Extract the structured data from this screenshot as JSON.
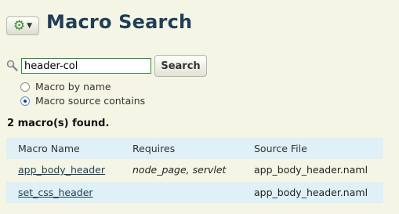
{
  "header": {
    "title": "Macro Search",
    "menu_icon": "gear-icon",
    "menu_caret": "chevron-down-icon"
  },
  "search": {
    "value": "header-col",
    "button_label": "Search",
    "icon": "magnifier-icon"
  },
  "options": [
    {
      "label": "Macro by name",
      "selected": false
    },
    {
      "label": "Macro source contains",
      "selected": true
    }
  ],
  "results": {
    "summary": "2 macro(s) found.",
    "columns": [
      "Macro Name",
      "Requires",
      "Source File"
    ],
    "rows": [
      {
        "name": "app_body_header",
        "requires": "node_page, servlet",
        "file": "app_body_header.naml"
      },
      {
        "name": "set_css_header",
        "requires": "",
        "file": "app_body_header.naml"
      }
    ]
  },
  "colors": {
    "background": "#f5f5e6",
    "title": "#1f3e57",
    "table_stripe": "#dff0f6",
    "gear": "#3c8f2c"
  }
}
